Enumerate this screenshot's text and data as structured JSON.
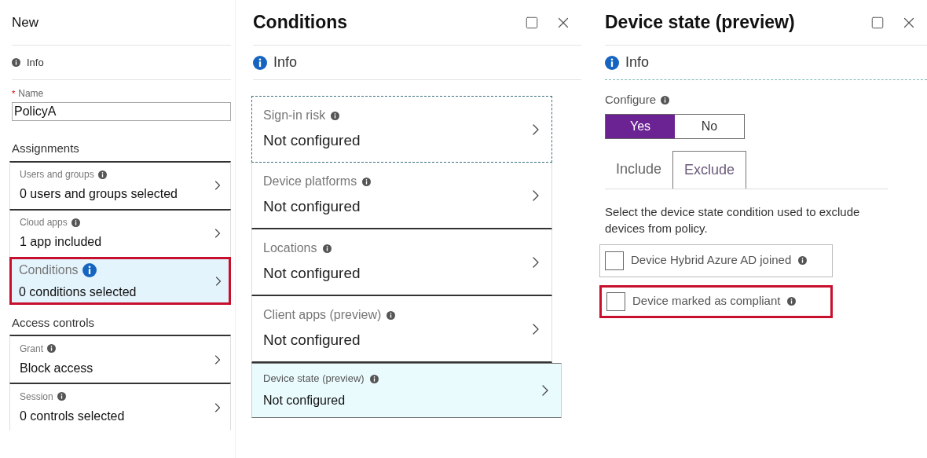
{
  "policy_panel": {
    "title": "New",
    "info": "Info",
    "name_field": {
      "label": "Name",
      "required_mark": "*",
      "value": "PolicyA"
    },
    "sections": [
      {
        "heading": "Assignments",
        "items": [
          {
            "label": "Users and groups",
            "value": "0 users and groups selected",
            "selected": false,
            "highlighted": false
          },
          {
            "label": "Cloud apps",
            "value": "1 app included",
            "selected": false,
            "highlighted": false
          },
          {
            "label": "Conditions",
            "value": "0 conditions selected",
            "selected": true,
            "highlighted": true
          }
        ]
      },
      {
        "heading": "Access controls",
        "items": [
          {
            "label": "Grant",
            "value": "Block access",
            "selected": false,
            "highlighted": false
          },
          {
            "label": "Session",
            "value": "0 controls selected",
            "selected": false,
            "highlighted": false
          }
        ]
      }
    ]
  },
  "conditions_panel": {
    "title": "Conditions",
    "info": "Info",
    "items": [
      {
        "label": "Sign-in risk",
        "value": "Not configured",
        "selected": false,
        "focused": true
      },
      {
        "label": "Device platforms",
        "value": "Not configured",
        "selected": false,
        "focused": false
      },
      {
        "label": "Locations",
        "value": "Not configured",
        "selected": false,
        "focused": false
      },
      {
        "label": "Client apps (preview)",
        "value": "Not configured",
        "selected": false,
        "focused": false
      },
      {
        "label": "Device state (preview)",
        "value": "Not configured",
        "selected": true,
        "focused": false
      }
    ]
  },
  "device_state_panel": {
    "title": "Device state (preview)",
    "info": "Info",
    "configure": {
      "label": "Configure",
      "options": [
        {
          "label": "Yes",
          "selected": true
        },
        {
          "label": "No",
          "selected": false
        }
      ]
    },
    "tabs": [
      {
        "label": "Include",
        "selected": false
      },
      {
        "label": "Exclude",
        "selected": true
      }
    ],
    "description": "Select the device state condition used to exclude devices from policy.",
    "checkboxes": [
      {
        "label": "Device Hybrid Azure AD joined",
        "checked": false,
        "highlighted": false
      },
      {
        "label": "Device marked as compliant",
        "checked": false,
        "highlighted": true
      }
    ]
  }
}
